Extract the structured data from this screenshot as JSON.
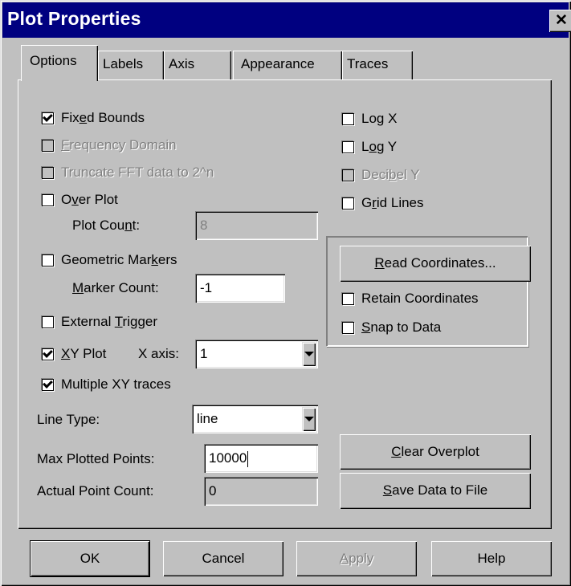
{
  "window": {
    "title": "Plot Properties",
    "close_glyph": "✕"
  },
  "tabs": [
    {
      "label": "Options",
      "active": true
    },
    {
      "label": "Labels",
      "active": false
    },
    {
      "label": "Axis",
      "active": false
    },
    {
      "label": "Appearance",
      "active": false
    },
    {
      "label": "Traces",
      "active": false
    }
  ],
  "options": {
    "fixed_bounds": {
      "label_pre": "Fix",
      "label_ul": "e",
      "label_post": "d Bounds",
      "checked": true,
      "enabled": true
    },
    "frequency_domain": {
      "label_pre": "",
      "label_ul": "F",
      "label_post": "requency Domain",
      "checked": false,
      "enabled": false
    },
    "truncate_fft": {
      "label": "Truncate FFT data to 2^n",
      "checked": false,
      "enabled": false
    },
    "over_plot": {
      "label_pre": "O",
      "label_ul": "v",
      "label_post": "er Plot",
      "checked": false,
      "enabled": true
    },
    "plot_count": {
      "label_pre": "Plot Cou",
      "label_ul": "n",
      "label_post": "t:",
      "value": "8",
      "enabled": false
    },
    "geometric_markers": {
      "label_pre": "Geometric Mar",
      "label_ul": "k",
      "label_post": "ers",
      "checked": false,
      "enabled": true
    },
    "marker_count": {
      "label_pre": "",
      "label_ul": "M",
      "label_post": "arker Count:",
      "value": "-1"
    },
    "external_trigger": {
      "label_pre": "External ",
      "label_ul": "T",
      "label_post": "rigger",
      "checked": false,
      "enabled": true
    },
    "xy_plot": {
      "label_pre": "",
      "label_ul": "X",
      "label_post": "Y Plot",
      "checked": true,
      "enabled": true
    },
    "x_axis": {
      "label": "X axis:",
      "value": "1"
    },
    "multiple_xy_traces": {
      "label": "Multiple XY traces",
      "checked": true,
      "enabled": true
    },
    "line_type": {
      "label": "Line Type:",
      "value": "line"
    },
    "max_plotted_points": {
      "label": "Max Plotted Points:",
      "value": "10000"
    },
    "actual_point_count": {
      "label": "Actual Point Count:",
      "value": "0"
    }
  },
  "right": {
    "log_x": {
      "label_pre": "Lo",
      "label_ul": "g",
      "label_post": " X",
      "checked": false,
      "enabled": true
    },
    "log_y": {
      "label_pre": "L",
      "label_ul": "o",
      "label_post": "g Y",
      "checked": false,
      "enabled": true
    },
    "decibel_y": {
      "label_pre": "Deci",
      "label_ul": "b",
      "label_post": "el Y",
      "checked": false,
      "enabled": false
    },
    "grid_lines": {
      "label_pre": "G",
      "label_ul": "r",
      "label_post": "id Lines",
      "checked": false,
      "enabled": true
    },
    "read_coordinates": {
      "label_pre": "",
      "label_ul": "R",
      "label_post": "ead Coordinates..."
    },
    "retain_coordinates": {
      "label": "Retain Coordinates",
      "checked": false
    },
    "snap_to_data": {
      "label_pre": "",
      "label_ul": "S",
      "label_post": "nap to Data",
      "checked": false
    },
    "clear_overplot": {
      "label_pre": "",
      "label_ul": "C",
      "label_post": "lear Overplot"
    },
    "save_data": {
      "label_pre": "",
      "label_ul": "S",
      "label_post": "ave Data to File"
    }
  },
  "footer": {
    "ok": "OK",
    "cancel": "Cancel",
    "apply_ul": "A",
    "apply_post": "pply",
    "help": "Help"
  }
}
